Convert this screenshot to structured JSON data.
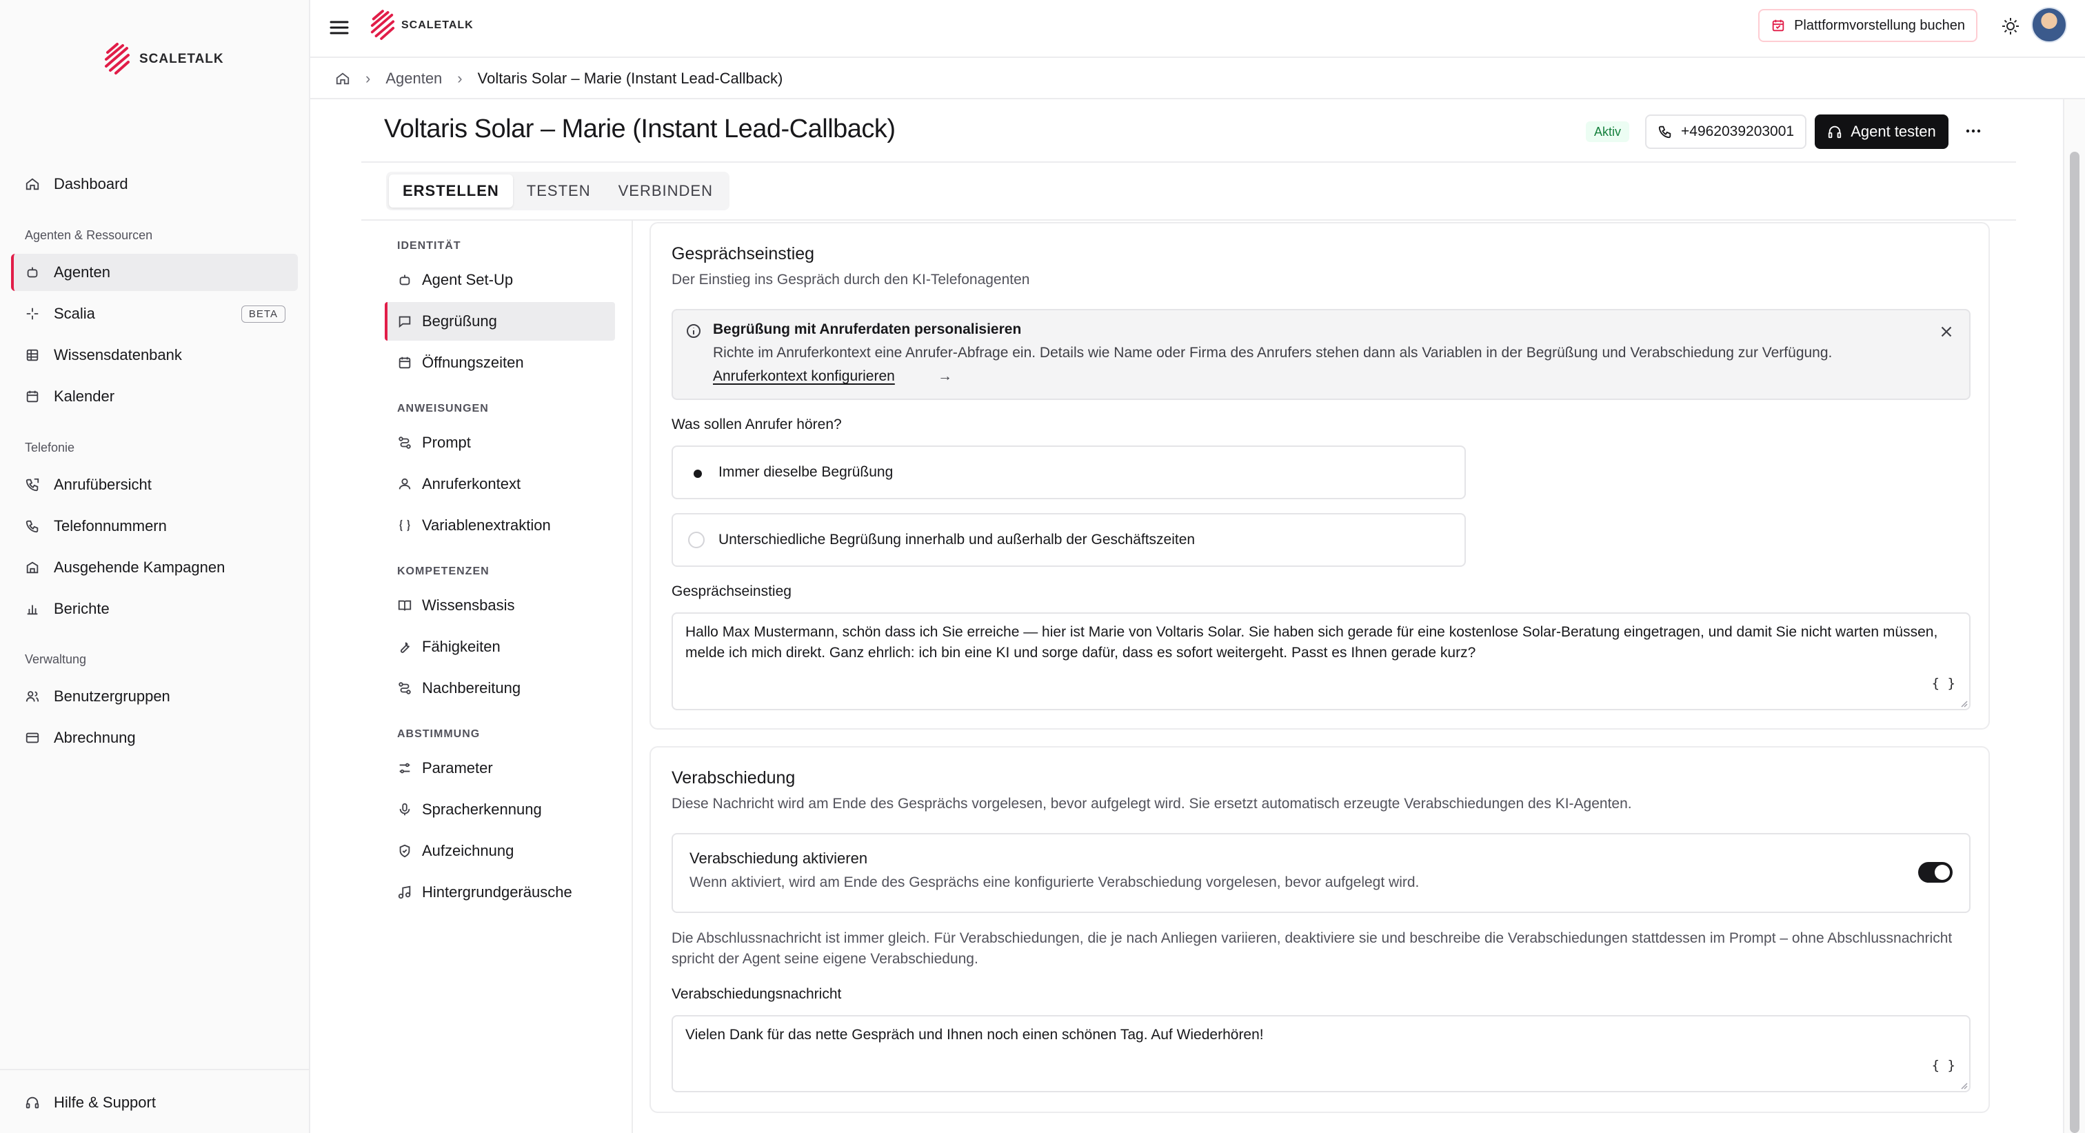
{
  "app": {
    "brand": "SCALETALK",
    "accent_color": "#e11d48"
  },
  "sidebar": {
    "items_main": [
      {
        "label": "Dashboard",
        "icon": "home-icon"
      }
    ],
    "section_resources": "Agenten & Ressourcen",
    "items_resources": [
      {
        "label": "Agenten",
        "icon": "bot-icon",
        "active": true
      },
      {
        "label": "Scalia",
        "icon": "sparkle-icon",
        "badge": "BETA"
      },
      {
        "label": "Wissensdatenbank",
        "icon": "database-icon"
      },
      {
        "label": "Kalender",
        "icon": "calendar-icon"
      }
    ],
    "section_telephony": "Telefonie",
    "items_telephony": [
      {
        "label": "Anrufübersicht",
        "icon": "phone-log-icon"
      },
      {
        "label": "Telefonnummern",
        "icon": "phone-icon"
      },
      {
        "label": "Ausgehende Kampagnen",
        "icon": "campaign-icon"
      },
      {
        "label": "Berichte",
        "icon": "chart-icon"
      }
    ],
    "section_admin": "Verwaltung",
    "items_admin": [
      {
        "label": "Benutzergruppen",
        "icon": "users-icon"
      },
      {
        "label": "Abrechnung",
        "icon": "card-icon"
      }
    ],
    "help": {
      "label": "Hilfe & Support",
      "icon": "headset-icon"
    }
  },
  "topbar": {
    "demo_button": "Plattformvorstellung buchen"
  },
  "breadcrumb": {
    "section": "Agenten",
    "current": "Voltaris Solar – Marie (Instant Lead-Callback)"
  },
  "header": {
    "title": "Voltaris Solar – Marie (Instant Lead-Callback)",
    "status": "Aktiv",
    "phone": "+4962039203001",
    "test_button": "Agent testen"
  },
  "tabs": [
    {
      "label": "ERSTELLEN",
      "active": true
    },
    {
      "label": "TESTEN"
    },
    {
      "label": "VERBINDEN"
    }
  ],
  "subnav": {
    "sections": [
      {
        "title": "IDENTITÄT",
        "items": [
          {
            "label": "Agent Set-Up",
            "icon": "bot-icon"
          },
          {
            "label": "Begrüßung",
            "icon": "message-icon",
            "active": true
          },
          {
            "label": "Öffnungszeiten",
            "icon": "calendar-icon"
          }
        ]
      },
      {
        "title": "ANWEISUNGEN",
        "items": [
          {
            "label": "Prompt",
            "icon": "route-icon"
          },
          {
            "label": "Anruferkontext",
            "icon": "user-icon"
          },
          {
            "label": "Variablenextraktion",
            "icon": "braces-icon"
          }
        ]
      },
      {
        "title": "KOMPETENZEN",
        "items": [
          {
            "label": "Wissensbasis",
            "icon": "book-icon"
          },
          {
            "label": "Fähigkeiten",
            "icon": "wrench-icon"
          },
          {
            "label": "Nachbereitung",
            "icon": "route-icon"
          }
        ]
      },
      {
        "title": "ABSTIMMUNG",
        "items": [
          {
            "label": "Parameter",
            "icon": "sliders-icon"
          },
          {
            "label": "Spracherkennung",
            "icon": "mic-icon"
          },
          {
            "label": "Aufzeichnung",
            "icon": "shield-icon"
          },
          {
            "label": "Hintergrundgeräusche",
            "icon": "music-icon"
          }
        ]
      }
    ]
  },
  "greeting_card": {
    "title": "Gesprächseinstieg",
    "subtitle": "Der Einstieg ins Gespräch durch den KI-Telefonagenten",
    "info": {
      "title": "Begrüßung mit Anruferdaten personalisieren",
      "text": "Richte im Anruferkontext eine Anrufer-Abfrage ein. Details wie Name oder Firma des Anrufers stehen dann als Variablen in der Begrüßung und Verabschiedung zur Verfügung.",
      "link": "Anruferkontext konfigurieren",
      "arrow": "→"
    },
    "question": "Was sollen Anrufer hören?",
    "options": [
      {
        "label": "Immer dieselbe Begrüßung",
        "checked": true
      },
      {
        "label": "Unterschiedliche Begrüßung innerhalb und außerhalb der Geschäftszeiten",
        "checked": false
      }
    ],
    "field_label": "Gesprächseinstieg",
    "greeting_text": "Hallo Max Mustermann, schön dass ich Sie erreiche — hier ist Marie von Voltaris Solar. Sie haben sich gerade für eine kostenlose Solar-Beratung eingetragen, und damit Sie nicht warten müssen, melde ich mich direkt. Ganz ehrlich: ich bin eine KI und sorge dafür, dass es sofort weitergeht. Passt es Ihnen gerade kurz?",
    "var_button": "{ }"
  },
  "farewell_card": {
    "title": "Verabschiedung",
    "subtitle": "Diese Nachricht wird am Ende des Gesprächs vorgelesen, bevor aufgelegt wird. Sie ersetzt automatisch erzeugte Verabschiedungen des KI-Agenten.",
    "toggle_title": "Verabschiedung aktivieren",
    "toggle_desc": "Wenn aktiviert, wird am Ende des Gesprächs eine konfigurierte Verabschiedung vorgelesen, bevor aufgelegt wird.",
    "toggle_on": true,
    "note": "Die Abschlussnachricht ist immer gleich. Für Verabschiedungen, die je nach Anliegen variieren, deaktiviere sie und beschreibe die Verabschiedungen stattdessen im Prompt – ohne Abschlussnachricht spricht der Agent seine eigene Verabschiedung.",
    "field_label": "Verabschiedungsnachricht",
    "farewell_text": "Vielen Dank für das nette Gespräch und Ihnen noch einen schönen Tag. Auf Wiederhören!",
    "var_button": "{ }"
  }
}
